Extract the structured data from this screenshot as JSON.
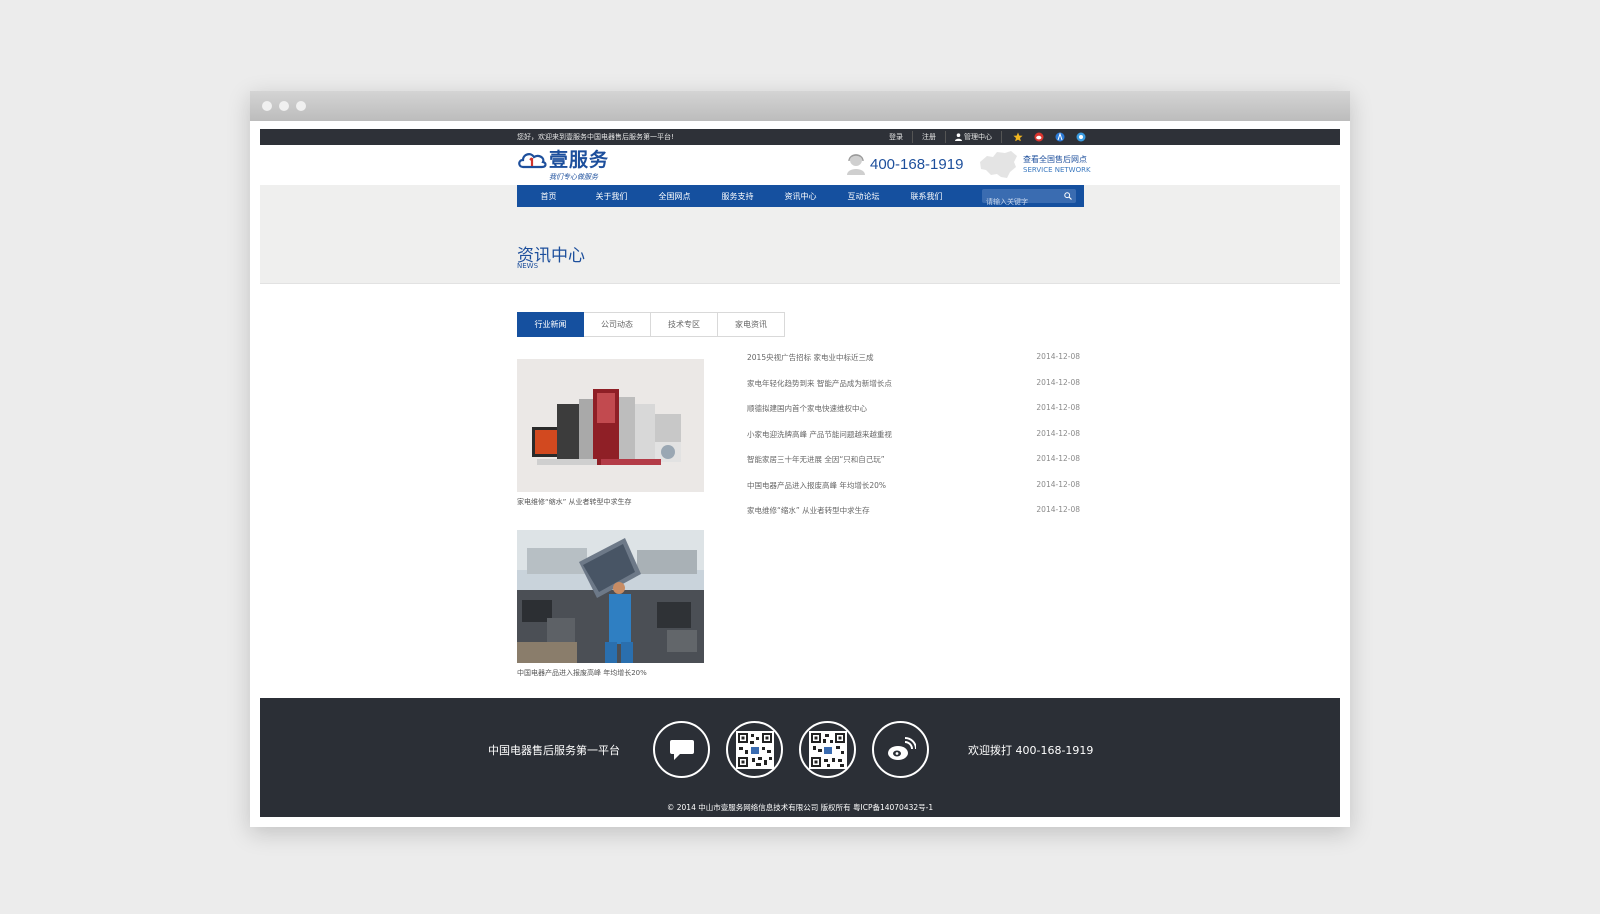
{
  "topbar": {
    "welcome": "您好，欢迎来到壹服务中国电器售后服务第一平台!",
    "login": "登录",
    "register": "注册",
    "admin": "管理中心"
  },
  "header": {
    "logo_text": "壹服务",
    "logo_slogan": "我们专心做服务",
    "hotline": "400-168-1919",
    "network_cn": "查看全国售后网点",
    "network_en": "SERVICE NETWORK"
  },
  "nav": {
    "items": [
      "首页",
      "关于我们",
      "全国网点",
      "服务支持",
      "资讯中心",
      "互动论坛",
      "联系我们"
    ],
    "search_placeholder": "请输入关键字"
  },
  "page": {
    "title": "资讯中心",
    "subtitle": "NEWS"
  },
  "tabs": [
    "行业新闻",
    "公司动态",
    "技术专区",
    "家电资讯"
  ],
  "features": [
    {
      "caption": "家电维修“缩水” 从业者转型中求生存"
    },
    {
      "caption": "中国电器产品进入报废高峰 年均增长20%"
    }
  ],
  "news": [
    {
      "title": "2015央视广告招标 家电业中标近三成",
      "date": "2014-12-08"
    },
    {
      "title": "家电年轻化趋势到来 智能产品成为新增长点",
      "date": "2014-12-08"
    },
    {
      "title": "顺德拟建国内首个家电快速维权中心",
      "date": "2014-12-08"
    },
    {
      "title": "小家电迎洗牌高峰 产品节能问题越来越重视",
      "date": "2014-12-08"
    },
    {
      "title": "智能家居三十年无进展 全因“只和自己玩”",
      "date": "2014-12-08"
    },
    {
      "title": "中国电器产品进入报废高峰 年均增长20%",
      "date": "2014-12-08"
    },
    {
      "title": "家电维修“缩水” 从业者转型中求生存",
      "date": "2014-12-08"
    }
  ],
  "footer": {
    "left_text": "中国电器售后服务第一平台",
    "right_text": "欢迎拨打 400-168-1919",
    "copyright": "© 2014 中山市壹服务网络信息技术有限公司 版权所有 粤ICP备14070432号-1",
    "icons": [
      "chat-icon",
      "qr-code-icon",
      "qr-code-icon",
      "weibo-icon"
    ]
  },
  "colors": {
    "brand_blue": "#15509f",
    "footer_bg": "#2b2f36",
    "topbar_bg": "#2e3138"
  }
}
